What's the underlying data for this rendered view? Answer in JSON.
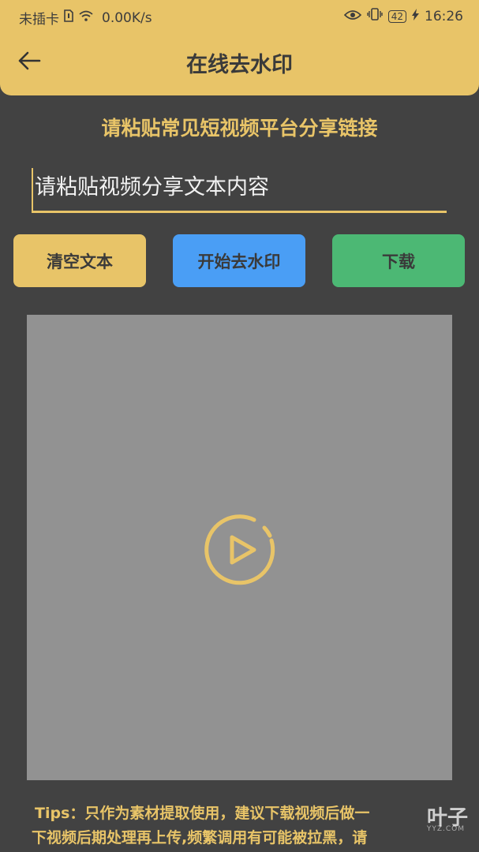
{
  "status_bar": {
    "carrier": "未插卡",
    "net_speed": "0.00K/s",
    "battery": "42",
    "time": "16:26"
  },
  "header": {
    "title": "在线去水印"
  },
  "main": {
    "subtitle": "请粘贴常见短视频平台分享链接",
    "input": {
      "value": "",
      "placeholder": "请粘贴视频分享文本内容"
    },
    "buttons": {
      "clear": "清空文本",
      "start": "开始去水印",
      "download": "下载"
    }
  },
  "tips": {
    "line1": "Tips：只作为素材提取使用，建议下载视频后做一",
    "line2": "下视频后期处理再上传,频繁调用有可能被拉黑，请"
  },
  "watermark": {
    "text": "叶子",
    "sub": "YYZ.COM"
  },
  "colors": {
    "accent": "#E8C468",
    "background": "#424242",
    "start_button": "#4A9EF5",
    "download_button": "#4CB874",
    "video_bg": "#929292"
  },
  "icons": {
    "back": "arrow-left-icon",
    "play": "play-circle-icon",
    "eye": "eye-icon",
    "vibrate": "vibrate-icon",
    "wifi": "wifi-icon",
    "sim": "sim-card-icon",
    "charging": "charging-icon"
  }
}
